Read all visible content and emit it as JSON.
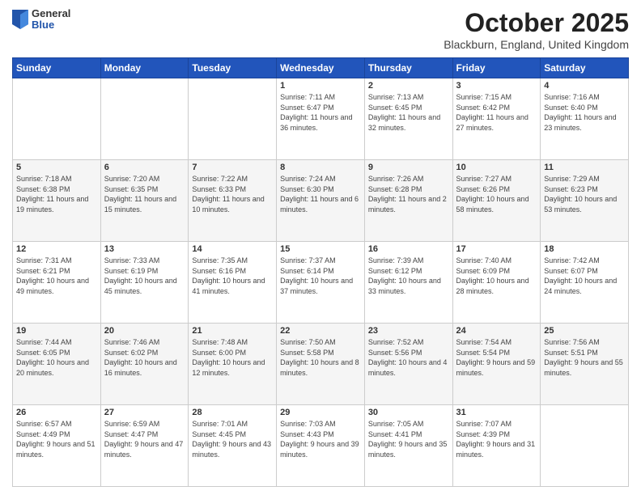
{
  "header": {
    "logo": {
      "general": "General",
      "blue": "Blue"
    },
    "title": "October 2025",
    "location": "Blackburn, England, United Kingdom"
  },
  "weekdays": [
    "Sunday",
    "Monday",
    "Tuesday",
    "Wednesday",
    "Thursday",
    "Friday",
    "Saturday"
  ],
  "weeks": [
    [
      {
        "day": "",
        "sunrise": "",
        "sunset": "",
        "daylight": ""
      },
      {
        "day": "",
        "sunrise": "",
        "sunset": "",
        "daylight": ""
      },
      {
        "day": "",
        "sunrise": "",
        "sunset": "",
        "daylight": ""
      },
      {
        "day": "1",
        "sunrise": "Sunrise: 7:11 AM",
        "sunset": "Sunset: 6:47 PM",
        "daylight": "Daylight: 11 hours and 36 minutes."
      },
      {
        "day": "2",
        "sunrise": "Sunrise: 7:13 AM",
        "sunset": "Sunset: 6:45 PM",
        "daylight": "Daylight: 11 hours and 32 minutes."
      },
      {
        "day": "3",
        "sunrise": "Sunrise: 7:15 AM",
        "sunset": "Sunset: 6:42 PM",
        "daylight": "Daylight: 11 hours and 27 minutes."
      },
      {
        "day": "4",
        "sunrise": "Sunrise: 7:16 AM",
        "sunset": "Sunset: 6:40 PM",
        "daylight": "Daylight: 11 hours and 23 minutes."
      }
    ],
    [
      {
        "day": "5",
        "sunrise": "Sunrise: 7:18 AM",
        "sunset": "Sunset: 6:38 PM",
        "daylight": "Daylight: 11 hours and 19 minutes."
      },
      {
        "day": "6",
        "sunrise": "Sunrise: 7:20 AM",
        "sunset": "Sunset: 6:35 PM",
        "daylight": "Daylight: 11 hours and 15 minutes."
      },
      {
        "day": "7",
        "sunrise": "Sunrise: 7:22 AM",
        "sunset": "Sunset: 6:33 PM",
        "daylight": "Daylight: 11 hours and 10 minutes."
      },
      {
        "day": "8",
        "sunrise": "Sunrise: 7:24 AM",
        "sunset": "Sunset: 6:30 PM",
        "daylight": "Daylight: 11 hours and 6 minutes."
      },
      {
        "day": "9",
        "sunrise": "Sunrise: 7:26 AM",
        "sunset": "Sunset: 6:28 PM",
        "daylight": "Daylight: 11 hours and 2 minutes."
      },
      {
        "day": "10",
        "sunrise": "Sunrise: 7:27 AM",
        "sunset": "Sunset: 6:26 PM",
        "daylight": "Daylight: 10 hours and 58 minutes."
      },
      {
        "day": "11",
        "sunrise": "Sunrise: 7:29 AM",
        "sunset": "Sunset: 6:23 PM",
        "daylight": "Daylight: 10 hours and 53 minutes."
      }
    ],
    [
      {
        "day": "12",
        "sunrise": "Sunrise: 7:31 AM",
        "sunset": "Sunset: 6:21 PM",
        "daylight": "Daylight: 10 hours and 49 minutes."
      },
      {
        "day": "13",
        "sunrise": "Sunrise: 7:33 AM",
        "sunset": "Sunset: 6:19 PM",
        "daylight": "Daylight: 10 hours and 45 minutes."
      },
      {
        "day": "14",
        "sunrise": "Sunrise: 7:35 AM",
        "sunset": "Sunset: 6:16 PM",
        "daylight": "Daylight: 10 hours and 41 minutes."
      },
      {
        "day": "15",
        "sunrise": "Sunrise: 7:37 AM",
        "sunset": "Sunset: 6:14 PM",
        "daylight": "Daylight: 10 hours and 37 minutes."
      },
      {
        "day": "16",
        "sunrise": "Sunrise: 7:39 AM",
        "sunset": "Sunset: 6:12 PM",
        "daylight": "Daylight: 10 hours and 33 minutes."
      },
      {
        "day": "17",
        "sunrise": "Sunrise: 7:40 AM",
        "sunset": "Sunset: 6:09 PM",
        "daylight": "Daylight: 10 hours and 28 minutes."
      },
      {
        "day": "18",
        "sunrise": "Sunrise: 7:42 AM",
        "sunset": "Sunset: 6:07 PM",
        "daylight": "Daylight: 10 hours and 24 minutes."
      }
    ],
    [
      {
        "day": "19",
        "sunrise": "Sunrise: 7:44 AM",
        "sunset": "Sunset: 6:05 PM",
        "daylight": "Daylight: 10 hours and 20 minutes."
      },
      {
        "day": "20",
        "sunrise": "Sunrise: 7:46 AM",
        "sunset": "Sunset: 6:02 PM",
        "daylight": "Daylight: 10 hours and 16 minutes."
      },
      {
        "day": "21",
        "sunrise": "Sunrise: 7:48 AM",
        "sunset": "Sunset: 6:00 PM",
        "daylight": "Daylight: 10 hours and 12 minutes."
      },
      {
        "day": "22",
        "sunrise": "Sunrise: 7:50 AM",
        "sunset": "Sunset: 5:58 PM",
        "daylight": "Daylight: 10 hours and 8 minutes."
      },
      {
        "day": "23",
        "sunrise": "Sunrise: 7:52 AM",
        "sunset": "Sunset: 5:56 PM",
        "daylight": "Daylight: 10 hours and 4 minutes."
      },
      {
        "day": "24",
        "sunrise": "Sunrise: 7:54 AM",
        "sunset": "Sunset: 5:54 PM",
        "daylight": "Daylight: 9 hours and 59 minutes."
      },
      {
        "day": "25",
        "sunrise": "Sunrise: 7:56 AM",
        "sunset": "Sunset: 5:51 PM",
        "daylight": "Daylight: 9 hours and 55 minutes."
      }
    ],
    [
      {
        "day": "26",
        "sunrise": "Sunrise: 6:57 AM",
        "sunset": "Sunset: 4:49 PM",
        "daylight": "Daylight: 9 hours and 51 minutes."
      },
      {
        "day": "27",
        "sunrise": "Sunrise: 6:59 AM",
        "sunset": "Sunset: 4:47 PM",
        "daylight": "Daylight: 9 hours and 47 minutes."
      },
      {
        "day": "28",
        "sunrise": "Sunrise: 7:01 AM",
        "sunset": "Sunset: 4:45 PM",
        "daylight": "Daylight: 9 hours and 43 minutes."
      },
      {
        "day": "29",
        "sunrise": "Sunrise: 7:03 AM",
        "sunset": "Sunset: 4:43 PM",
        "daylight": "Daylight: 9 hours and 39 minutes."
      },
      {
        "day": "30",
        "sunrise": "Sunrise: 7:05 AM",
        "sunset": "Sunset: 4:41 PM",
        "daylight": "Daylight: 9 hours and 35 minutes."
      },
      {
        "day": "31",
        "sunrise": "Sunrise: 7:07 AM",
        "sunset": "Sunset: 4:39 PM",
        "daylight": "Daylight: 9 hours and 31 minutes."
      },
      {
        "day": "",
        "sunrise": "",
        "sunset": "",
        "daylight": ""
      }
    ]
  ]
}
